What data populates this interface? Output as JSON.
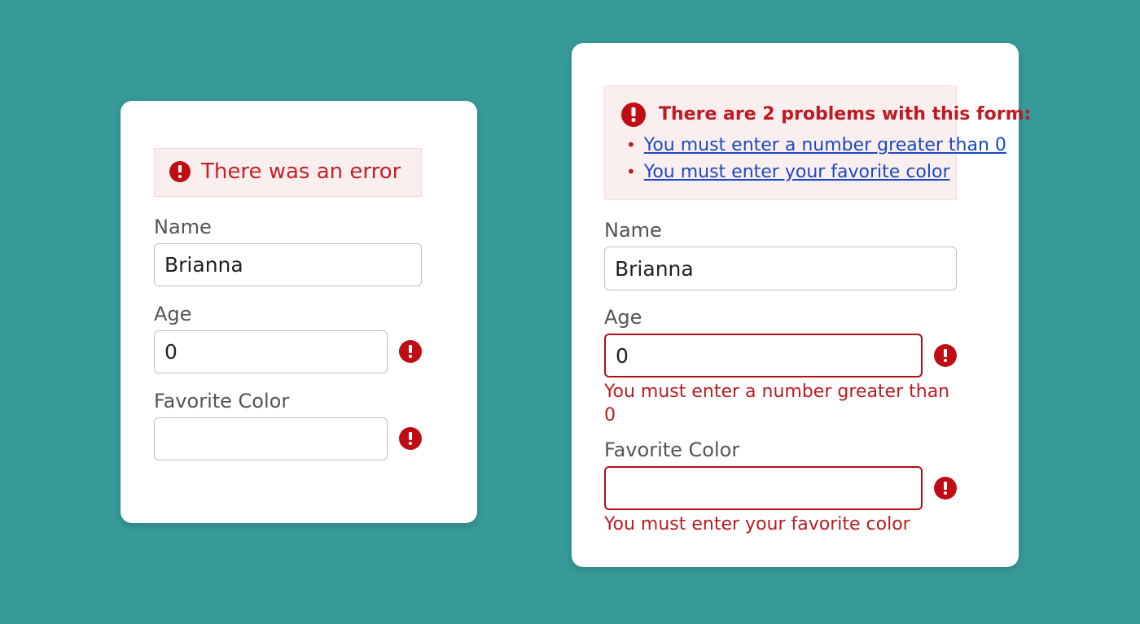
{
  "page": {
    "background_color": "#379a99",
    "card_background": "#ffffff"
  },
  "colors": {
    "error_red": "#c00d14",
    "error_text_red": "#b81c20",
    "banner_bg": "#fbeeee",
    "banner_border": "#f4dcdc",
    "link_blue": "#1a49c4",
    "label_gray": "#545454",
    "input_border": "#bfbfbf",
    "invalid_border": "#b11116"
  },
  "basic_card": {
    "banner": {
      "icon": "error-circle-icon",
      "message": "There was an error"
    },
    "fields": [
      {
        "label": "Name",
        "value": "Brianna",
        "placeholder": "",
        "invalid": false,
        "icon": null
      },
      {
        "label": "Age",
        "value": "0",
        "placeholder": "",
        "invalid": false,
        "icon": "error-circle-icon"
      },
      {
        "label": "Favorite Color",
        "value": "",
        "placeholder": "",
        "invalid": false,
        "icon": "error-circle-icon"
      }
    ]
  },
  "rich_card": {
    "banner": {
      "icon": "error-circle-icon",
      "title": "There are 2 problems with this form:",
      "bullet_glyph": "•",
      "links": [
        "You must enter a number greater than 0",
        "You must enter your favorite color"
      ]
    },
    "fields": [
      {
        "label": "Name",
        "value": "Brianna",
        "placeholder": "",
        "invalid": false,
        "icon": null,
        "error": null
      },
      {
        "label": "Age",
        "value": "0",
        "placeholder": "",
        "invalid": true,
        "icon": "error-circle-icon",
        "error": "You must enter a number greater than 0"
      },
      {
        "label": "Favorite Color",
        "value": "",
        "placeholder": "",
        "invalid": true,
        "icon": "error-circle-icon",
        "error": "You must enter your favorite color"
      }
    ]
  }
}
